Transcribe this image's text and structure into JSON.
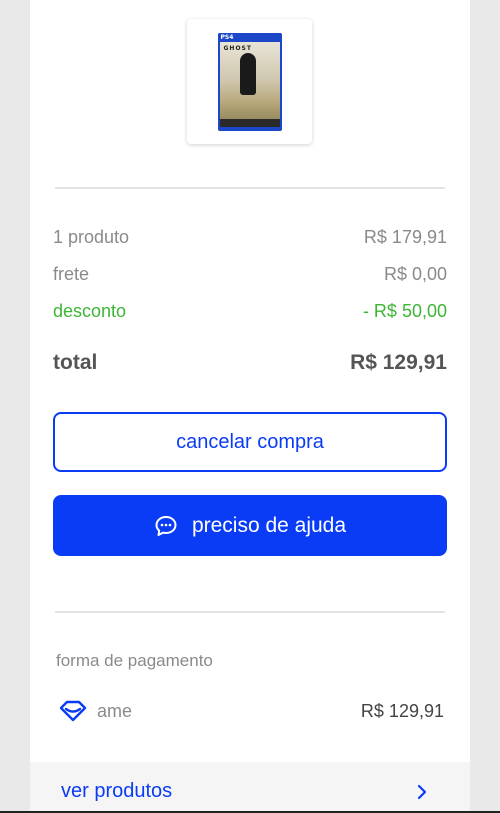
{
  "product": {
    "image_alt": "Ghost of Tsushima PS4 cover",
    "platform_badge": "PS4",
    "cover_logo": "GHOST"
  },
  "summary": {
    "items_label": "1 produto",
    "items_value": "R$ 179,91",
    "shipping_label": "frete",
    "shipping_value": "R$ 0,00",
    "discount_label": "desconto",
    "discount_value": "- R$ 50,00",
    "total_label": "total",
    "total_value": "R$ 129,91"
  },
  "actions": {
    "cancel_label": "cancelar compra",
    "help_label": "preciso de ajuda",
    "help_icon": "chat-bubble-icon"
  },
  "payment": {
    "section_label": "forma de pagamento",
    "method_icon": "ame-diamond-icon",
    "method_name": "ame",
    "method_amount": "R$ 129,91"
  },
  "footer": {
    "products_link_label": "ver produtos",
    "chevron_icon": "chevron-right-icon"
  },
  "colors": {
    "accent": "#0a3cf5",
    "discount": "#3db535",
    "muted_text": "#8a8a8a",
    "background": "#e9e9e9"
  }
}
